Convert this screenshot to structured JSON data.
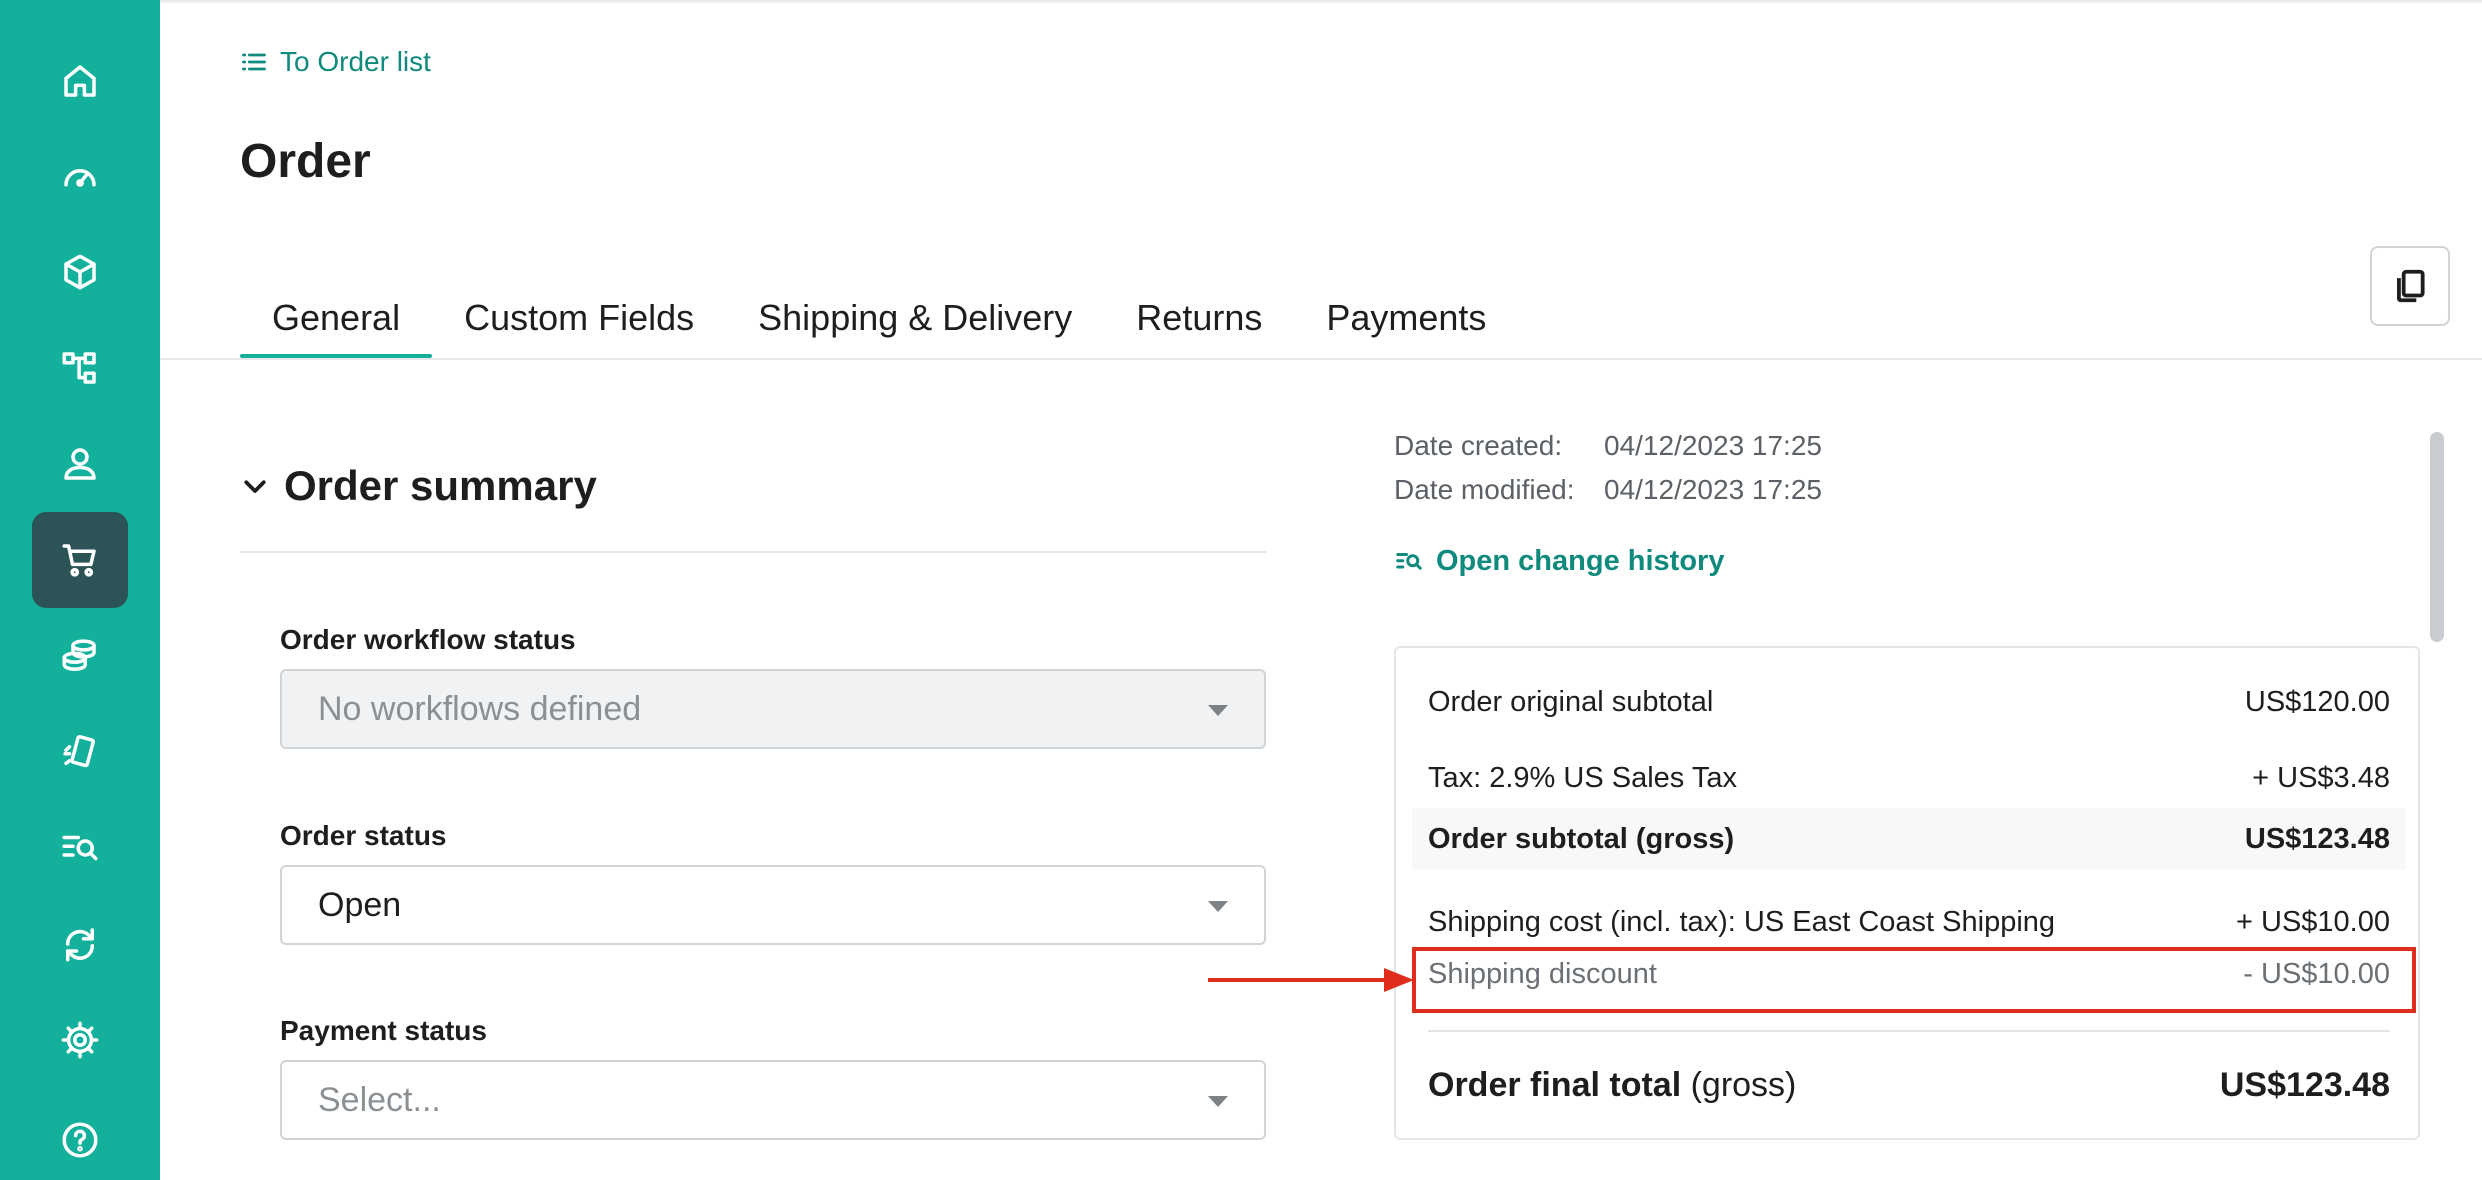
{
  "sidebar": {
    "items": [
      {
        "icon": "home-icon"
      },
      {
        "icon": "dashboard-icon"
      },
      {
        "icon": "box-icon"
      },
      {
        "icon": "category-tree-icon"
      },
      {
        "icon": "user-icon"
      },
      {
        "icon": "cart-icon",
        "active": true
      },
      {
        "icon": "coins-icon"
      },
      {
        "icon": "marketing-icon"
      },
      {
        "icon": "search-list-icon"
      },
      {
        "icon": "sync-icon"
      },
      {
        "icon": "settings-gear-icon"
      },
      {
        "icon": "help-icon"
      }
    ],
    "accent_color": "#13b09c",
    "active_color": "#2c5457"
  },
  "header": {
    "back_link": "To Order list",
    "title": "Order"
  },
  "tabs": [
    {
      "label": "General",
      "active": true
    },
    {
      "label": "Custom Fields"
    },
    {
      "label": "Shipping & Delivery"
    },
    {
      "label": "Returns"
    },
    {
      "label": "Payments"
    }
  ],
  "summary": {
    "title": "Order summary",
    "workflow": {
      "label": "Order workflow status",
      "value": "No workflows defined"
    },
    "order_status": {
      "label": "Order status",
      "value": "Open"
    },
    "payment_status": {
      "label": "Payment status",
      "placeholder": "Select..."
    }
  },
  "meta": {
    "created_label": "Date created:",
    "created_value": "04/12/2023 17:25",
    "modified_label": "Date modified:",
    "modified_value": "04/12/2023 17:25",
    "history_link": "Open change history"
  },
  "totals": {
    "original_subtotal": {
      "label": "Order original subtotal",
      "value": "US$120.00"
    },
    "tax": {
      "label": "Tax: 2.9% US Sales Tax",
      "value": "+ US$3.48"
    },
    "gross_subtotal": {
      "label": "Order subtotal (gross)",
      "value": "US$123.48"
    },
    "shipping_cost": {
      "label": "Shipping cost (incl. tax): US East Coast Shipping",
      "value": "+ US$10.00"
    },
    "shipping_discount": {
      "label": "Shipping discount",
      "value": "- US$10.00"
    },
    "final_total": {
      "label": "Order final total",
      "label_suffix": "(gross)",
      "value": "US$123.48"
    }
  },
  "annotation_color": "#e02d1b"
}
